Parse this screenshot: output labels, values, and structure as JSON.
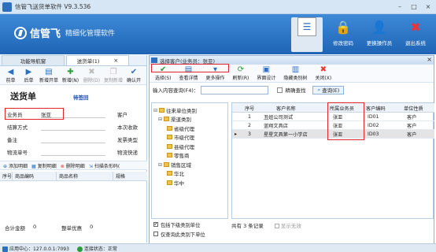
{
  "window": {
    "title": "信管飞送货单软件 V9.3.536"
  },
  "banner": {
    "brand": "信管飞",
    "slogan": "精细化管理软件",
    "actions": [
      {
        "label": "",
        "icon": "doc-icon"
      },
      {
        "label": "修改密码",
        "icon": "lock-icon"
      },
      {
        "label": "更换操作员",
        "icon": "user-icon"
      },
      {
        "label": "退出系统",
        "icon": "exit-icon"
      }
    ]
  },
  "left": {
    "tabs": [
      {
        "label": "功能导航窗"
      },
      {
        "label": "送货单(1)",
        "close": "×"
      }
    ],
    "toolbar": [
      "前单",
      "后单",
      "新增开单",
      "新增(N)",
      "删除(D)",
      "复制新增",
      "确认开"
    ],
    "doc_title": "送货单",
    "doc_status": "待签回",
    "fields": [
      {
        "label": "业务员",
        "value": "张亚",
        "right": "客户"
      },
      {
        "label": "结算方式",
        "value": "",
        "right": "本次收款"
      },
      {
        "label": "备注",
        "value": "",
        "right": "发票类型"
      },
      {
        "label": "物流单号",
        "value": "",
        "right": "物流快递"
      }
    ],
    "detail_toolbar": [
      "添加明细",
      "复制明细",
      "删除明细",
      "扫描条形码("
    ],
    "detail_columns": [
      "序号",
      "商品编码",
      "商品名称",
      "规格"
    ],
    "total_label": "合计金额",
    "total_value": "0",
    "discount_label": "整单优惠",
    "discount_value": "0"
  },
  "dialog": {
    "title": "选择客户(业务员：张亚)",
    "toolbar": [
      "选择(S)",
      "查看详情",
      "更多操作",
      "刷新(R)",
      "界面设计",
      "隐藏类别树",
      "关闭(X)"
    ],
    "search_label": "输入内容查询(F4)：",
    "search_value": "",
    "precise_label": "精确查找",
    "query_button": "查询(E)",
    "tree": [
      {
        "label": "往来单位类别",
        "level": 0
      },
      {
        "label": "渠道类别",
        "level": 1
      },
      {
        "label": "省级代理",
        "level": 2
      },
      {
        "label": "市级代理",
        "level": 2
      },
      {
        "label": "县级代理",
        "level": 2
      },
      {
        "label": "零售商",
        "level": 2
      },
      {
        "label": "销售区域",
        "level": 1
      },
      {
        "label": "华北",
        "level": 2
      },
      {
        "label": "华中",
        "level": 2
      }
    ],
    "tree_options": [
      {
        "label": "包括下级类别单位",
        "checked": true
      },
      {
        "label": "仅查询此类别下单位",
        "checked": false
      }
    ],
    "columns": [
      "序号",
      "客户名称",
      "所属业务员",
      "客户编码",
      "单位性质"
    ],
    "rows": [
      {
        "no": "1",
        "name": "丑妞公司测试",
        "owner": "张亚",
        "code": "ID01",
        "type": "客户"
      },
      {
        "no": "2",
        "name": "蓝翔文具店",
        "owner": "张亚",
        "code": "ID02",
        "type": "客户"
      },
      {
        "no": "3",
        "name": "星星文具第一小学店",
        "owner": "张亚",
        "code": "ID03",
        "type": "客户"
      }
    ],
    "record_count": "共有 3 条记录",
    "show_disabled": "显示无效"
  },
  "status": {
    "app_center": "应用中心：127.0.0.1:7093",
    "connection": "连接状态：正常"
  }
}
